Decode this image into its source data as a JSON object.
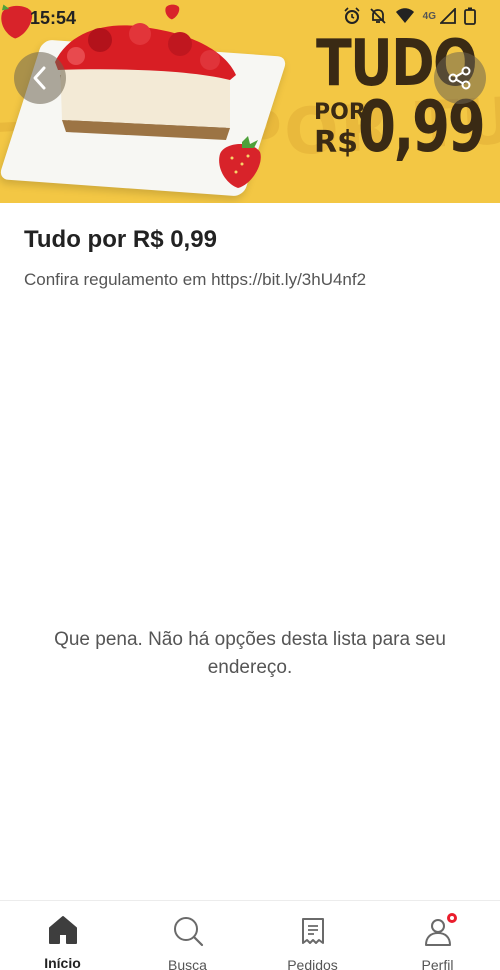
{
  "status_bar": {
    "time": "15:54",
    "network": "4G",
    "icons": [
      "alarm-icon",
      "muted-bell-icon",
      "wifi-icon",
      "signal-icon",
      "battery-icon"
    ]
  },
  "banner": {
    "promo_title": "TUDO",
    "promo_por": "POR",
    "promo_currency": "R$",
    "promo_price": "0,99",
    "background_text": "TUDO POR TUDO",
    "colors": {
      "background": "#f3c744",
      "text": "#3a2a14"
    },
    "back_icon": "chevron-left-icon",
    "share_icon": "share-icon"
  },
  "page": {
    "title": "Tudo por R$ 0,99",
    "subtitle": "Confira regulamento em https://bit.ly/3hU4nf2",
    "empty_message": "Que pena. Não há opções desta lista para seu endereço."
  },
  "bottom_nav": {
    "items": [
      {
        "label": "Início",
        "icon": "home-icon",
        "active": true
      },
      {
        "label": "Busca",
        "icon": "search-icon",
        "active": false
      },
      {
        "label": "Pedidos",
        "icon": "orders-icon",
        "active": false
      },
      {
        "label": "Perfil",
        "icon": "profile-icon",
        "active": false,
        "badge": true
      }
    ]
  },
  "colors": {
    "accent": "#ea1d2c",
    "text": "#3e3e3e"
  }
}
